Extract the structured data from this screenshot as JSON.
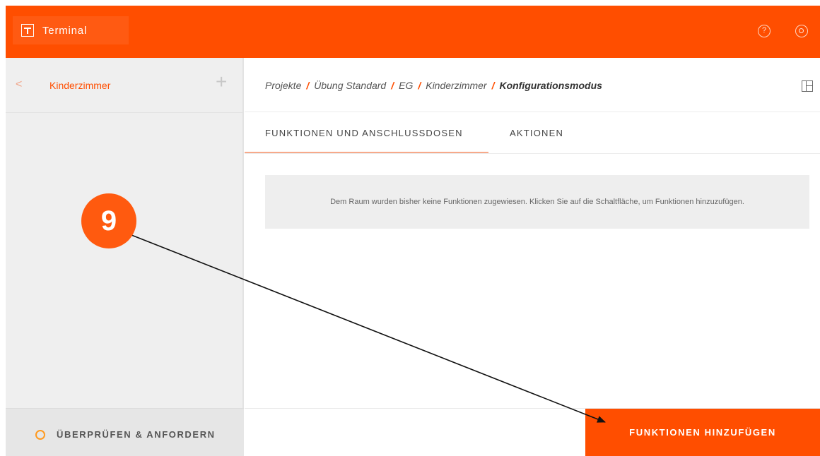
{
  "app": {
    "title": "Terminal",
    "accent": "#ff4e00"
  },
  "topbar": {
    "help_icon": "help-icon",
    "settings_icon": "gear-icon",
    "help_glyph": "?"
  },
  "sidebar": {
    "back_glyph": "<",
    "room_title": "Kinderzimmer",
    "plus_glyph": "+",
    "review_label": "ÜBERPRÜFEN & ANFORDERN"
  },
  "breadcrumb": {
    "items": [
      "Projekte",
      "Übung Standard",
      "EG",
      "Kinderzimmer"
    ],
    "current": "Konfigurationsmodus",
    "separator": "/"
  },
  "tabs": [
    {
      "label": "FUNKTIONEN UND ANSCHLUSSDOSEN",
      "active": true
    },
    {
      "label": "AKTIONEN",
      "active": false
    }
  ],
  "main": {
    "info_text": "Dem Raum wurden bisher keine Funktionen zugewiesen. Klicken Sie auf die Schaltfläche, um Funktionen hinzuzufügen.",
    "add_button_label": "FUNKTIONEN HINZUFÜGEN"
  },
  "annotation": {
    "step_number": "9"
  }
}
